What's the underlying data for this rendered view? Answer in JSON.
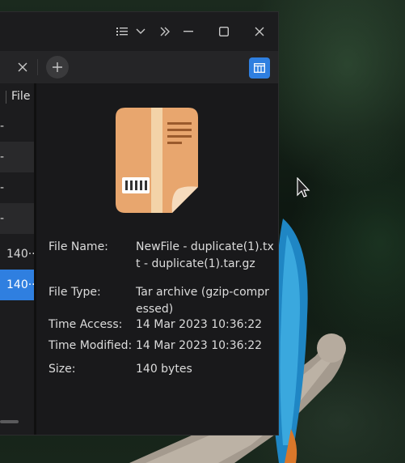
{
  "titlebar": {
    "icons": [
      "list-view-icon",
      "chevron-down-icon",
      "double-chevron-right-icon",
      "minimize-icon",
      "maximize-icon",
      "close-icon"
    ]
  },
  "tabbar": {
    "icons": [
      "tab-close-icon",
      "add-tab-icon",
      "detail-view-toggle-icon"
    ]
  },
  "list": {
    "column_header": "File",
    "rows": [
      {
        "text": "-"
      },
      {
        "text": "-"
      },
      {
        "text": "-"
      },
      {
        "text": "-"
      },
      {
        "text": "140···"
      },
      {
        "text": "140···"
      }
    ]
  },
  "details": {
    "file_name_label": "File Name:",
    "file_name_value": "NewFile - duplicate(1).txt - duplicate(1).tar.gz",
    "file_type_label": "File Type:",
    "file_type_value": "Tar archive (gzip-compressed)",
    "time_access_label": "Time Access:",
    "time_access_value": "14 Mar 2023 10:36:22",
    "time_modified_label": "Time Modified:",
    "time_modified_value": "14 Mar 2023 10:36:22",
    "size_label": "Size:",
    "size_value": "140 bytes"
  },
  "colors": {
    "accent": "#2f7fe0",
    "window_bg": "#1c1c1e",
    "archive_icon": "#e8a66e"
  }
}
